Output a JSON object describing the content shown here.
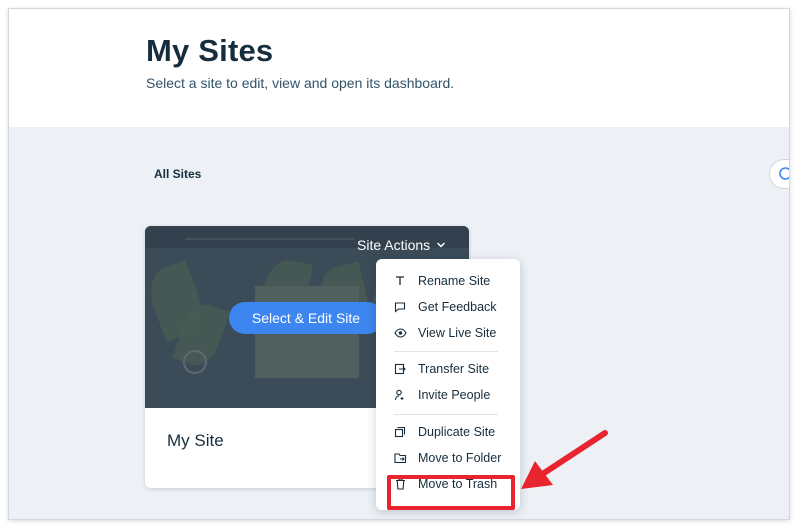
{
  "header": {
    "title": "My Sites",
    "subtitle": "Select a site to edit, view and open its dashboard."
  },
  "filters": {
    "all_sites": "All Sites"
  },
  "site_card": {
    "site_actions_label": "Site Actions",
    "select_edit_label": "Select & Edit Site",
    "site_name": "My Site"
  },
  "menu": {
    "items": [
      {
        "label": "Rename Site",
        "icon": "text-t-icon"
      },
      {
        "label": "Get Feedback",
        "icon": "comment-icon"
      },
      {
        "label": "View Live Site",
        "icon": "eye-icon"
      },
      {
        "label": "Transfer Site",
        "icon": "transfer-icon"
      },
      {
        "label": "Invite People",
        "icon": "invite-person-icon"
      },
      {
        "label": "Duplicate Site",
        "icon": "duplicate-icon"
      },
      {
        "label": "Move to Folder",
        "icon": "folder-move-icon"
      },
      {
        "label": "Move to Trash",
        "icon": "trash-icon"
      }
    ]
  },
  "colors": {
    "accent_blue": "#3d86ef",
    "annotation_red": "#e8252e",
    "title_dark": "#162d3d"
  }
}
